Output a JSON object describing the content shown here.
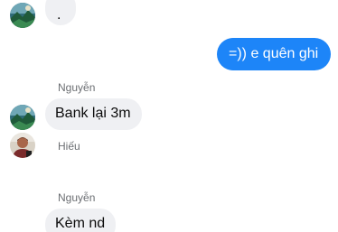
{
  "conversation": {
    "messages": [
      {
        "text": "."
      },
      {
        "text": "=)) e quên ghi"
      },
      {
        "sender": "Nguyễn",
        "text": "Bank lại 3m"
      },
      {
        "sender": "Hiếu"
      },
      {
        "sender": "Nguyễn",
        "text": "Kèm nd"
      }
    ]
  },
  "colors": {
    "outgoing_bubble": "#1d85f8",
    "incoming_bubble": "#eff0f3",
    "sender_name": "#6b6e72"
  },
  "icons": {
    "avatar_nguyen": "landscape-photo-avatar",
    "avatar_hieu": "person-photo-avatar"
  }
}
